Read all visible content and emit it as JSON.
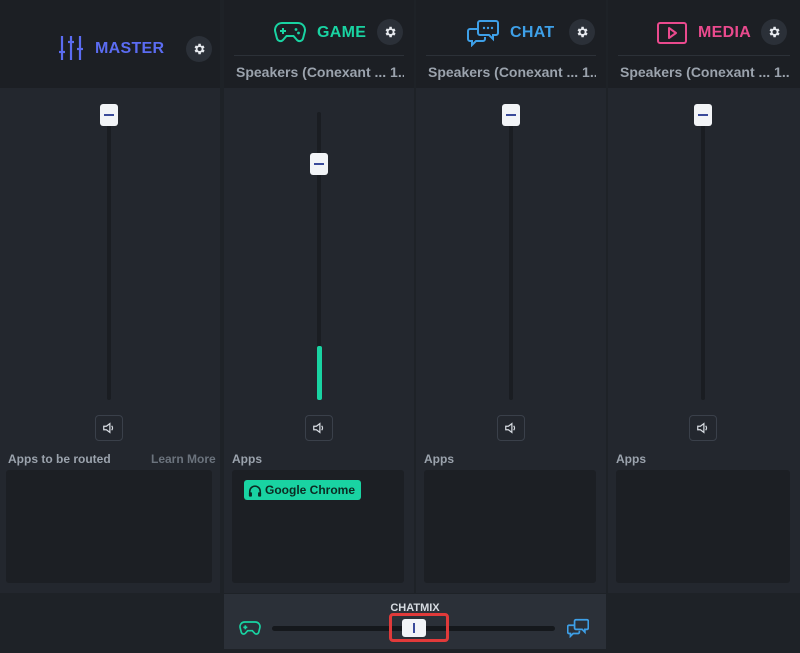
{
  "colors": {
    "master": "#5b6cf2",
    "game": "#19d3a2",
    "chat": "#3ea0e8",
    "media": "#ea4a8e",
    "highlight": "#e13a3a"
  },
  "master": {
    "title": "MASTER",
    "icon": "sliders-icon",
    "apps_label": "Apps to be routed",
    "learn_more": "Learn More",
    "volume_level": 1.0
  },
  "game": {
    "title": "GAME",
    "icon": "gamepad-icon",
    "device": "Speakers (Conexant ... 1...",
    "apps_label": "Apps",
    "apps": [
      "Google Chrome"
    ],
    "volume_level": 0.82,
    "meter_level": 0.19
  },
  "chat": {
    "title": "CHAT",
    "icon": "chat-bubbles-icon",
    "device": "Speakers (Conexant ... 1...",
    "apps_label": "Apps",
    "volume_level": 1.0
  },
  "media": {
    "title": "MEDIA",
    "icon": "play-icon",
    "device": "Speakers (Conexant ... 1...",
    "apps_label": "Apps",
    "volume_level": 1.0
  },
  "chatmix": {
    "label": "CHATMIX",
    "balance": 0.5,
    "left_icon": "gamepad-icon",
    "right_icon": "chat-bubbles-icon"
  }
}
